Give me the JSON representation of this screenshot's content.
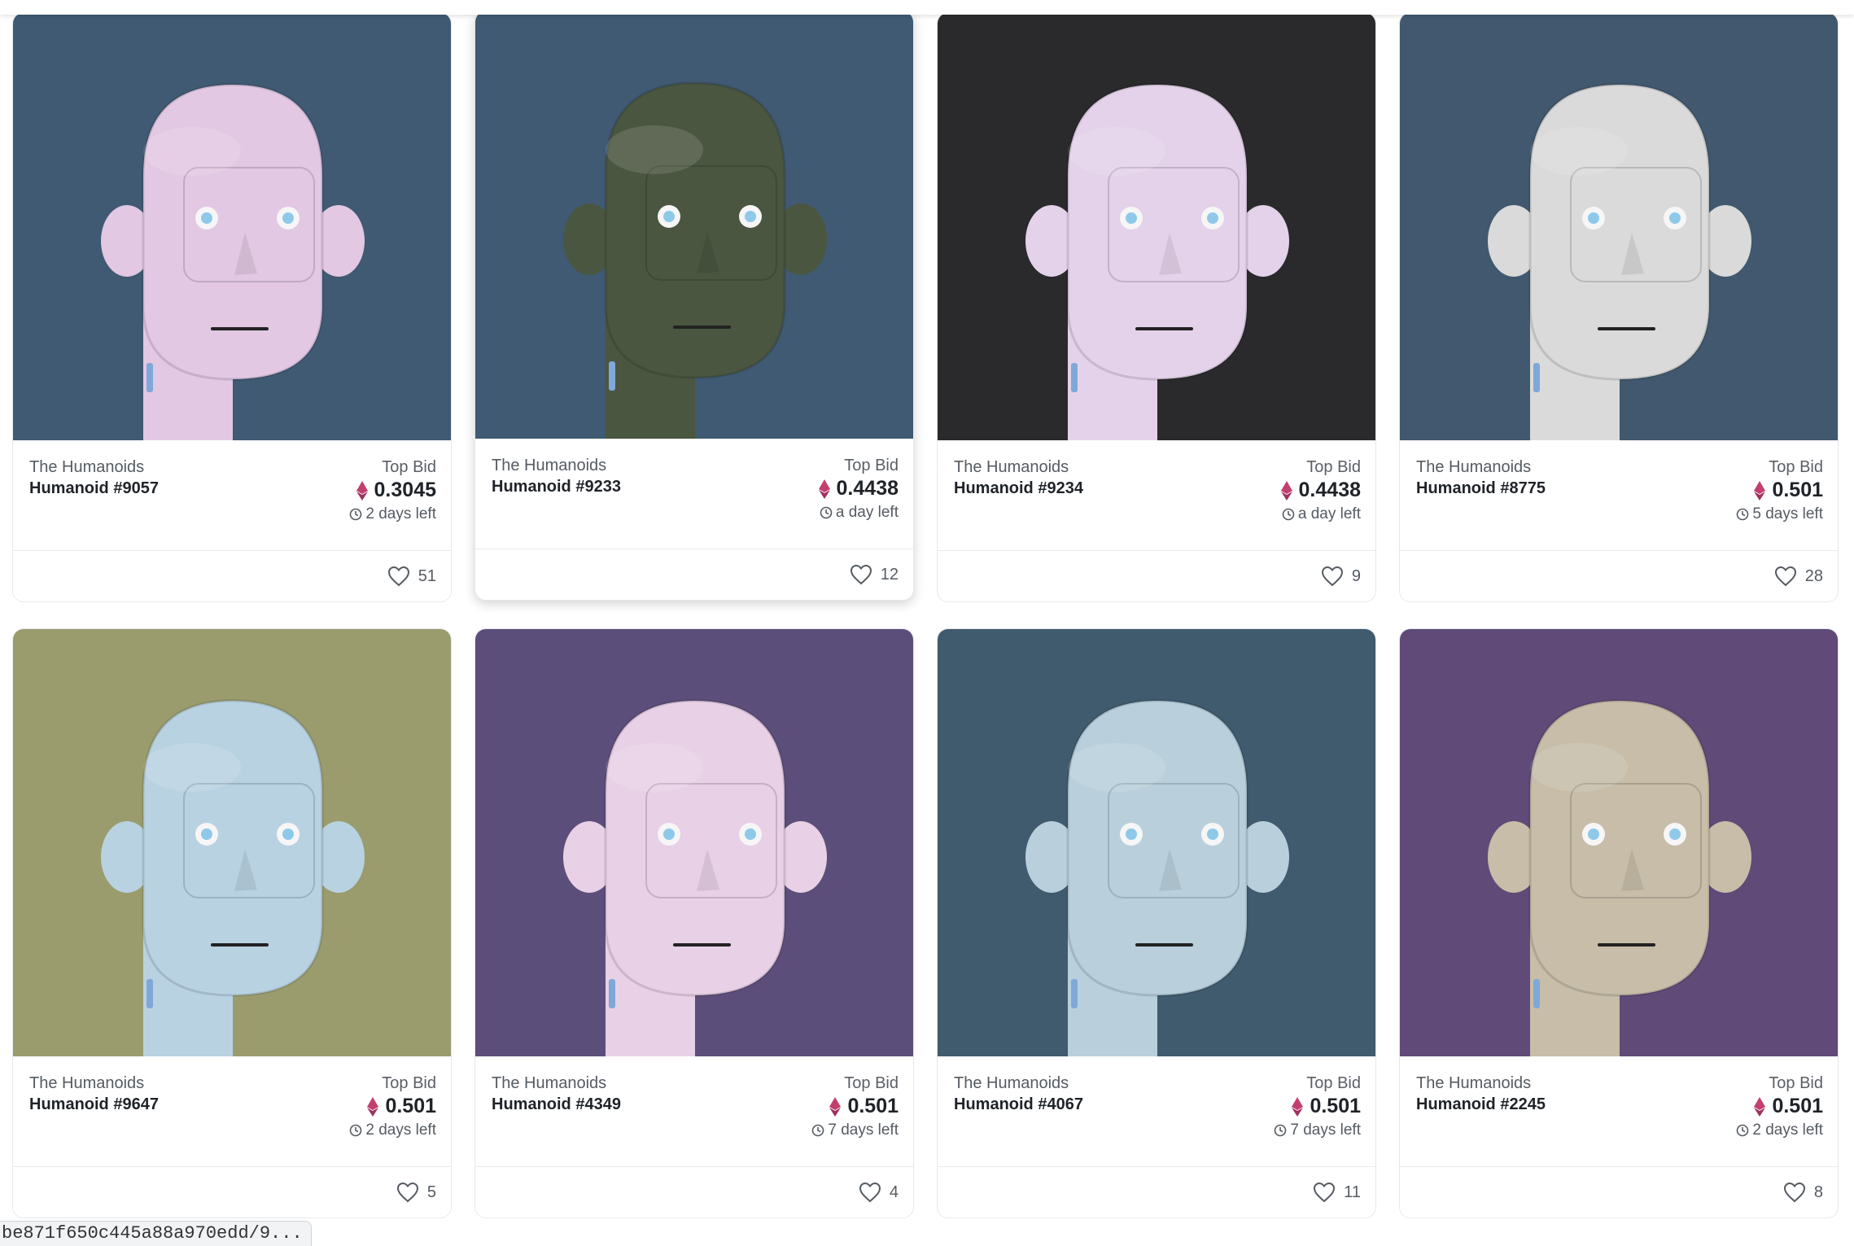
{
  "cards": [
    {
      "collection": "The Humanoids",
      "name": "Humanoid #9057",
      "top_bid_label": "Top Bid",
      "price": "0.3045",
      "time_left": "2 days left",
      "likes": "51",
      "bg": "#3f5a72",
      "skin": "#e2c8e3"
    },
    {
      "collection": "The Humanoids",
      "name": "Humanoid #9233",
      "top_bid_label": "Top Bid",
      "price": "0.4438",
      "time_left": "a day left",
      "likes": "12",
      "bg": "#3f5a72",
      "skin": "#4a5640"
    },
    {
      "collection": "The Humanoids",
      "name": "Humanoid #9234",
      "top_bid_label": "Top Bid",
      "price": "0.4438",
      "time_left": "a day left",
      "likes": "9",
      "bg": "#2a2a2c",
      "skin": "#e4d2ea"
    },
    {
      "collection": "The Humanoids",
      "name": "Humanoid #8775",
      "top_bid_label": "Top Bid",
      "price": "0.501",
      "time_left": "5 days left",
      "likes": "28",
      "bg": "#41586e",
      "skin": "#d9dad9"
    },
    {
      "collection": "The Humanoids",
      "name": "Humanoid #9647",
      "top_bid_label": "Top Bid",
      "price": "0.501",
      "time_left": "2 days left",
      "likes": "5",
      "bg": "#9a9c6e",
      "skin": "#b9d2e2"
    },
    {
      "collection": "The Humanoids",
      "name": "Humanoid #4349",
      "top_bid_label": "Top Bid",
      "price": "0.501",
      "time_left": "7 days left",
      "likes": "4",
      "bg": "#5c4e7a",
      "skin": "#e8d0e6"
    },
    {
      "collection": "The Humanoids",
      "name": "Humanoid #4067",
      "top_bid_label": "Top Bid",
      "price": "0.501",
      "time_left": "7 days left",
      "likes": "11",
      "bg": "#405a6e",
      "skin": "#b9d0dc"
    },
    {
      "collection": "The Humanoids",
      "name": "Humanoid #2245",
      "top_bid_label": "Top Bid",
      "price": "0.501",
      "time_left": "2 days left",
      "likes": "8",
      "bg": "#5f4a78",
      "skin": "#c7bda9"
    }
  ],
  "status_url": "be871f650c445a88a970edd/9..."
}
